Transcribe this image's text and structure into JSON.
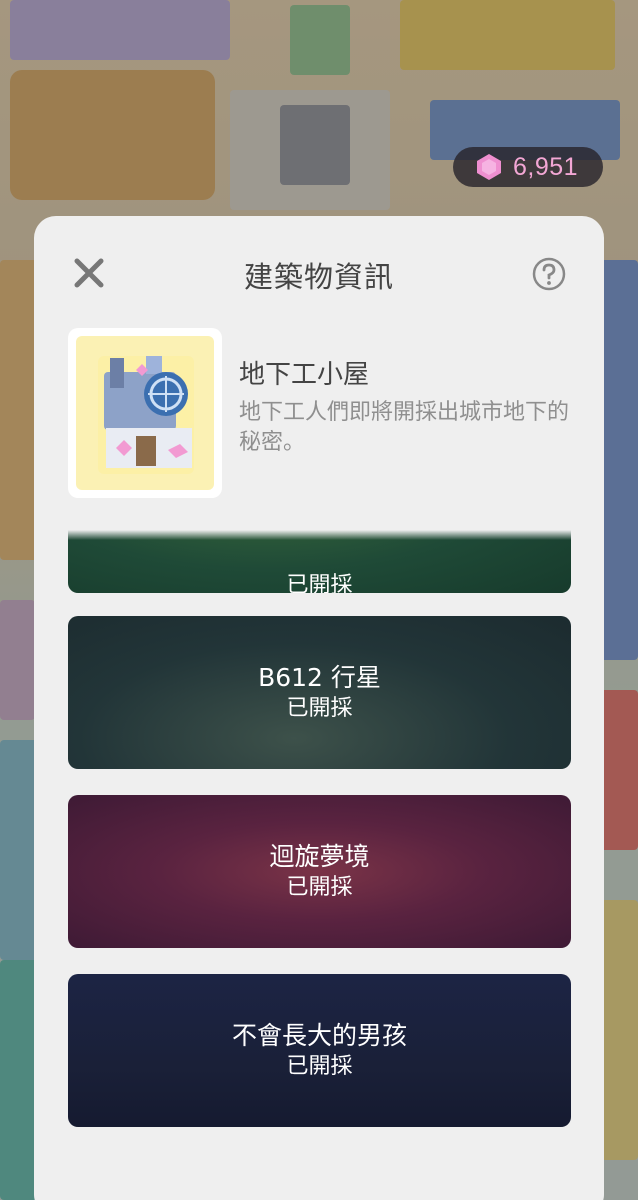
{
  "hud": {
    "gem_icon": "pink-gem-icon",
    "gem_count": "6,951",
    "gem_color": "#f08ccb"
  },
  "modal": {
    "title": "建築物資訊",
    "close_icon": "close-icon",
    "help_icon": "help-icon",
    "building": {
      "name": "地下工小屋",
      "description": "地下工人們即將開採出城市地下的秘密。",
      "thumbnail_icon": "miner-hut-icon"
    },
    "mines": [
      {
        "name": "",
        "status": "已開採",
        "color": "#1f4a37"
      },
      {
        "name": "B612 行星",
        "status": "已開採",
        "color": "#203338"
      },
      {
        "name": "迴旋夢境",
        "status": "已開採",
        "color": "#4e1f35"
      },
      {
        "name": "不會長大的男孩",
        "status": "已開採",
        "color": "#1a2038"
      }
    ]
  }
}
